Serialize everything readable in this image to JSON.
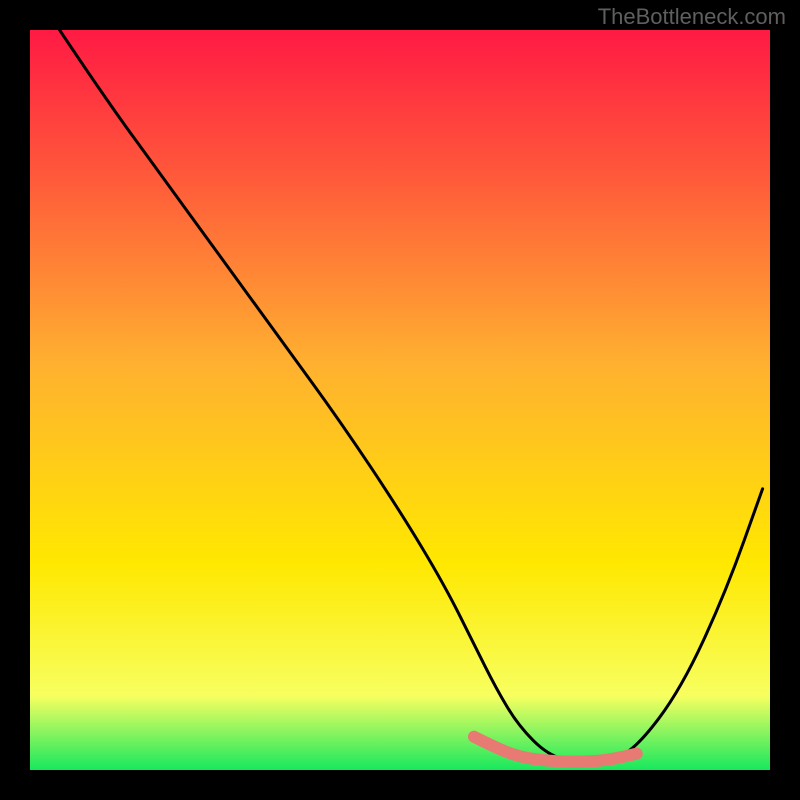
{
  "watermark": "TheBottleneck.com",
  "chart_data": {
    "type": "line",
    "title": "",
    "xlabel": "",
    "ylabel": "",
    "xlim": [
      0,
      100
    ],
    "ylim": [
      0,
      100
    ],
    "background_gradient": {
      "top": "#ff1a44",
      "middle": "#ffe800",
      "bottom": "#17e85e"
    },
    "black_curve": {
      "comment": "Approximate V-shaped bottleneck curve; y = 0 is bottom (green), y = 100 is top (red)",
      "x": [
        4,
        10,
        18,
        26,
        34,
        42,
        50,
        56,
        60,
        63,
        66,
        70,
        74,
        78,
        82,
        88,
        94,
        99
      ],
      "y": [
        100,
        91,
        80,
        69,
        58,
        47,
        35,
        25,
        17,
        11,
        6,
        2,
        1,
        1,
        3,
        11,
        24,
        38
      ]
    },
    "highlight_band": {
      "comment": "Salmon-colored optimal zone near the trough",
      "color": "#e77a72",
      "x": [
        60,
        63,
        66,
        70,
        74,
        78,
        82
      ],
      "y": [
        4.5,
        3,
        1.8,
        1.2,
        1.1,
        1.3,
        2.2
      ]
    }
  }
}
